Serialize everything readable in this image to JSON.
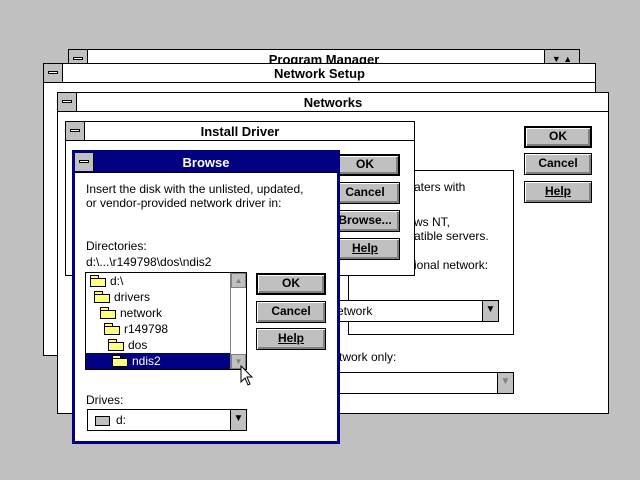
{
  "program_manager": {
    "title": "Program Manager"
  },
  "network_setup": {
    "title": "Network Setup",
    "buttons": {
      "ok": "OK",
      "cancel": "Cancel",
      "help": "Help"
    }
  },
  "networks": {
    "title": "Networks",
    "text_fragments": {
      "line1": "aters with",
      "line2": "ws NT,",
      "line3": "atible servers.",
      "line4": "ional network:",
      "line5": "twork only:"
    },
    "network_combo": {
      "value": "etwork"
    }
  },
  "install_driver": {
    "title": "Install Driver",
    "buttons": {
      "ok": "OK",
      "cancel": "Cancel",
      "browse": "Browse...",
      "help": "Help"
    }
  },
  "browse": {
    "title": "Browse",
    "prompt_line1": "Insert the disk with the unlisted, updated,",
    "prompt_line2": "or vendor-provided network driver in:",
    "directories_label": "Directories:",
    "current_path": "d:\\...\\r149798\\dos\\ndis2",
    "tree": [
      {
        "label": "d:\\",
        "selected": false
      },
      {
        "label": "drivers",
        "selected": false
      },
      {
        "label": "network",
        "selected": false
      },
      {
        "label": "r149798",
        "selected": false
      },
      {
        "label": "dos",
        "selected": false
      },
      {
        "label": "ndis2",
        "selected": true
      }
    ],
    "drives_label": "Drives:",
    "drive_value": "d:",
    "buttons": {
      "ok": "OK",
      "cancel": "Cancel",
      "help": "Help"
    }
  }
}
